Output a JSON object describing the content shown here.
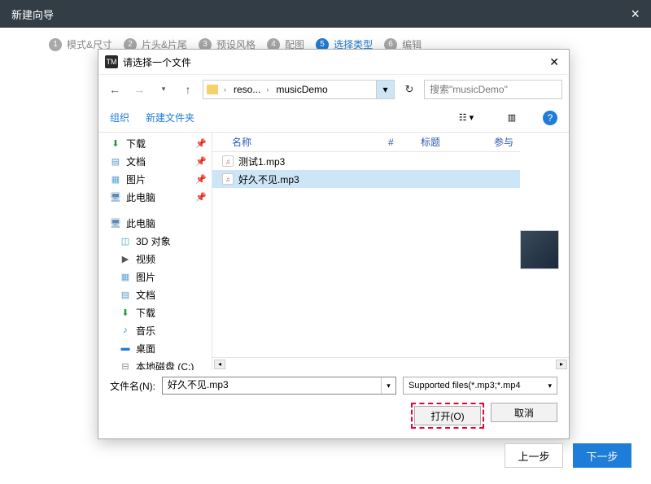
{
  "wizard": {
    "title": "新建向导",
    "steps": [
      "模式&尺寸",
      "片头&片尾",
      "预设风格",
      "配图",
      "选择类型",
      "编辑"
    ],
    "active_index": 4,
    "prev_btn": "上一步",
    "next_btn": "下一步"
  },
  "dialog": {
    "title": "请选择一个文件",
    "path": [
      "reso...",
      "musicDemo"
    ],
    "search_placeholder": "搜索\"musicDemo\"",
    "toolbar": {
      "organize": "组织",
      "new_folder": "新建文件夹"
    },
    "tree_quick": [
      {
        "icon": "dl",
        "label": "下载",
        "pin": true
      },
      {
        "icon": "doc",
        "label": "文档",
        "pin": true
      },
      {
        "icon": "pic",
        "label": "图片",
        "pin": true
      },
      {
        "icon": "pc",
        "label": "此电脑",
        "pin": true
      }
    ],
    "tree_pc_label": "此电脑",
    "tree_pc": [
      {
        "icon": "obj",
        "label": "3D 对象"
      },
      {
        "icon": "vid",
        "label": "视频"
      },
      {
        "icon": "pic",
        "label": "图片"
      },
      {
        "icon": "doc",
        "label": "文档"
      },
      {
        "icon": "dl",
        "label": "下载"
      },
      {
        "icon": "mus",
        "label": "音乐"
      },
      {
        "icon": "desk",
        "label": "桌面"
      },
      {
        "icon": "disk",
        "label": "本地磁盘 (C:)"
      }
    ],
    "columns": {
      "name": "名称",
      "num": "#",
      "title": "标题",
      "part": "参与"
    },
    "files": [
      {
        "name": "测试1.mp3",
        "selected": false
      },
      {
        "name": "好久不见.mp3",
        "selected": true
      }
    ],
    "filename_label": "文件名(N):",
    "filename_value": "好久不见.mp3",
    "filter": "Supported files(*.mp3;*.mp4",
    "open_btn": "打开(O)",
    "cancel_btn": "取消"
  }
}
